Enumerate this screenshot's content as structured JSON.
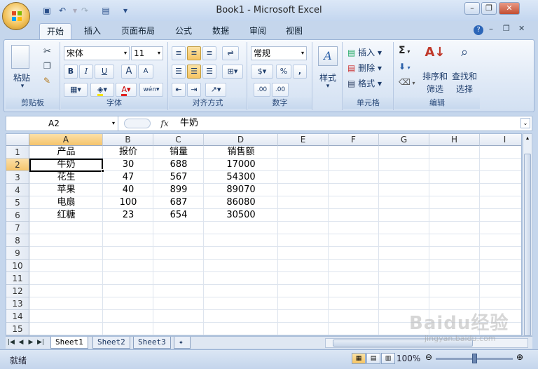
{
  "window": {
    "title": "Book1 - Microsoft Excel"
  },
  "quick_access": [
    "save-icon",
    "undo-icon",
    "redo-icon",
    "form-icon",
    "customize-icon"
  ],
  "tabs": [
    {
      "label": "开始",
      "active": true
    },
    {
      "label": "插入"
    },
    {
      "label": "页面布局"
    },
    {
      "label": "公式"
    },
    {
      "label": "数据"
    },
    {
      "label": "审阅"
    },
    {
      "label": "视图"
    }
  ],
  "ribbon": {
    "clipboard": {
      "paste": "粘贴",
      "label": "剪贴板"
    },
    "font": {
      "name": "宋体",
      "size": "11",
      "bold": "B",
      "italic": "I",
      "underline": "U",
      "grow": "A",
      "shrink": "A",
      "label": "字体"
    },
    "alignment": {
      "label": "对齐方式"
    },
    "number": {
      "format": "常规",
      "percent": "%",
      "comma": ",",
      "inc": ".00",
      "dec": ".00",
      "label": "数字"
    },
    "styles": {
      "label": "样式"
    },
    "cells": {
      "insert": "插入",
      "delete": "删除",
      "format": "格式",
      "label": "单元格"
    },
    "editing": {
      "sort": "排序和",
      "sort2": "筛选",
      "find": "查找和",
      "find2": "选择",
      "sigma": "Σ",
      "label": "编辑"
    }
  },
  "formula_bar": {
    "name_box": "A2",
    "fx": "fx",
    "value": "牛奶"
  },
  "columns": [
    "A",
    "B",
    "C",
    "D",
    "E",
    "F",
    "G",
    "H",
    "I"
  ],
  "rows": [
    "1",
    "2",
    "3",
    "4",
    "5",
    "6",
    "7",
    "8",
    "9",
    "10",
    "11",
    "12",
    "13",
    "14",
    "15"
  ],
  "table": [
    [
      "产品",
      "报价",
      "销量",
      "销售额"
    ],
    [
      "牛奶",
      "30",
      "688",
      "17000"
    ],
    [
      "花生",
      "47",
      "567",
      "54300"
    ],
    [
      "苹果",
      "40",
      "899",
      "89070"
    ],
    [
      "电扇",
      "100",
      "687",
      "86080"
    ],
    [
      "红糖",
      "23",
      "654",
      "30500"
    ]
  ],
  "selected_cell": "A2",
  "sheets": [
    "Sheet1",
    "Sheet2",
    "Sheet3"
  ],
  "active_sheet": "Sheet1",
  "status": {
    "text": "就绪",
    "zoom": "100%"
  },
  "watermark": {
    "main": "Baidu经验",
    "sub": "jingyan.baidu.com"
  }
}
